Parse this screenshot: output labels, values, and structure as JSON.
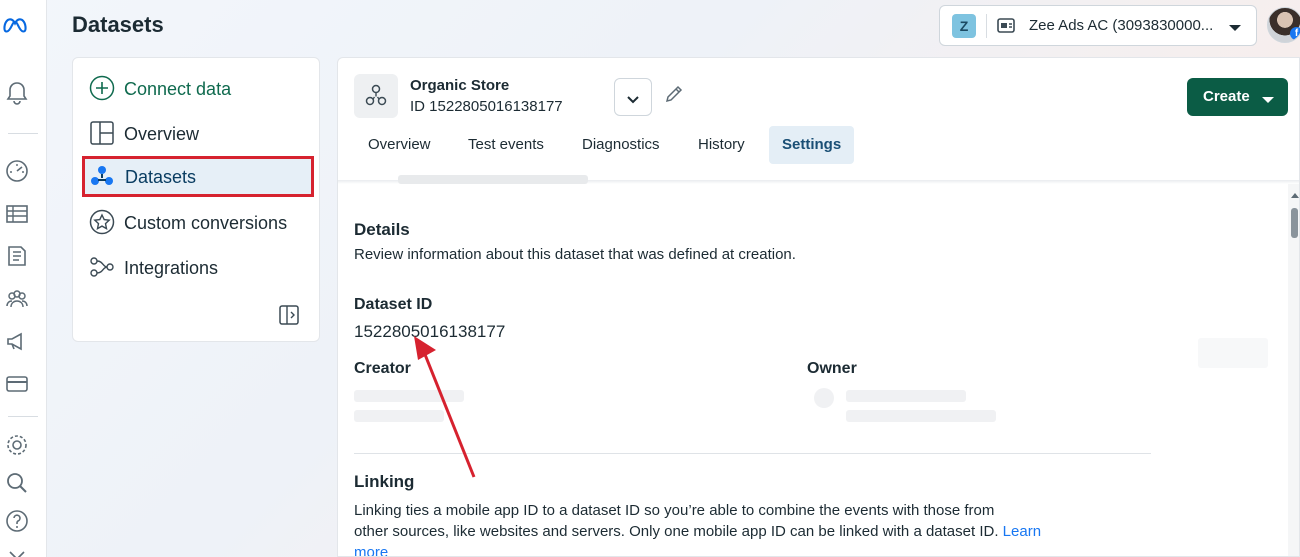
{
  "app": {
    "page_title": "Datasets"
  },
  "account": {
    "badge_letter": "Z",
    "name": "Zee Ads AC (3093830000..."
  },
  "nav": {
    "connect_label": "Connect data",
    "items": [
      {
        "label": "Overview",
        "icon": "overview-layout-icon"
      },
      {
        "label": "Datasets",
        "icon": "datasets-icon",
        "selected": true
      },
      {
        "label": "Custom conversions",
        "icon": "custom-conversions-star-icon"
      },
      {
        "label": "Integrations",
        "icon": "integrations-icon"
      }
    ]
  },
  "dataset": {
    "name": "Organic Store",
    "id_line": "ID 1522805016138177"
  },
  "header": {
    "create_label": "Create"
  },
  "tabs": [
    {
      "label": "Overview"
    },
    {
      "label": "Test events"
    },
    {
      "label": "Diagnostics"
    },
    {
      "label": "History"
    },
    {
      "label": "Settings",
      "active": true
    }
  ],
  "details": {
    "heading": "Details",
    "description": "Review information about this dataset that was defined at creation.",
    "dataset_id_label": "Dataset ID",
    "dataset_id_value": "1522805016138177",
    "creator_label": "Creator",
    "owner_label": "Owner"
  },
  "linking": {
    "heading": "Linking",
    "text_line1": "Linking ties a mobile app ID to a dataset ID so you’re able to combine the events with those from",
    "text_line2": "other sources, like websites and servers. Only one mobile app ID can be linked with a dataset ID.",
    "learn_more_part1": "Learn",
    "learn_more_part2": "more"
  },
  "colors": {
    "accent": "#1877f2",
    "create_button": "#0b5c45",
    "selection_outline": "#d6222f",
    "annotation_arrow": "#d6222f"
  }
}
